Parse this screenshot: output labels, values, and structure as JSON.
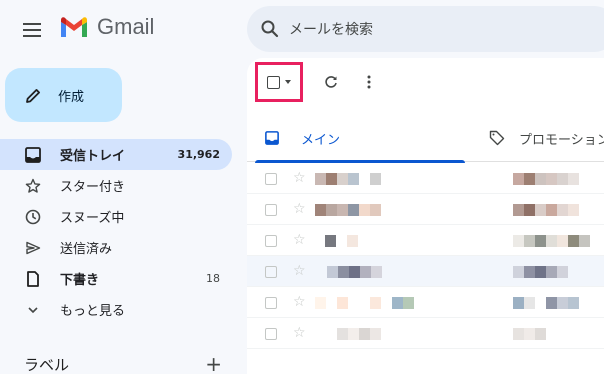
{
  "app": {
    "name": "Gmail"
  },
  "search": {
    "placeholder": "メールを検索"
  },
  "compose": {
    "label": "作成"
  },
  "nav": {
    "items": [
      {
        "label": "受信トレイ",
        "count": "31,962",
        "icon": "inbox-icon"
      },
      {
        "label": "スター付き",
        "count": "",
        "icon": "star-icon"
      },
      {
        "label": "スヌーズ中",
        "count": "",
        "icon": "clock-icon"
      },
      {
        "label": "送信済み",
        "count": "",
        "icon": "send-icon"
      },
      {
        "label": "下書き",
        "count": "18",
        "icon": "file-icon"
      },
      {
        "label": "もっと見る",
        "count": "",
        "icon": "chevron-down-icon"
      }
    ]
  },
  "labels": {
    "title": "ラベル",
    "add_symbol": "+"
  },
  "toolbar": {
    "select_icon": "checkbox-icon",
    "refresh_icon": "refresh-icon",
    "more_icon": "more-vert-icon"
  },
  "tabs": [
    {
      "label": "メイン",
      "icon": "inbox-icon",
      "selected": true
    },
    {
      "label": "プロモーション",
      "icon": "tag-icon",
      "selected": false
    }
  ],
  "colors": {
    "accent": "#0b57d0",
    "compose_bg": "#c2e7ff",
    "highlight": "#e8205f",
    "active_nav": "#d3e3fd"
  }
}
